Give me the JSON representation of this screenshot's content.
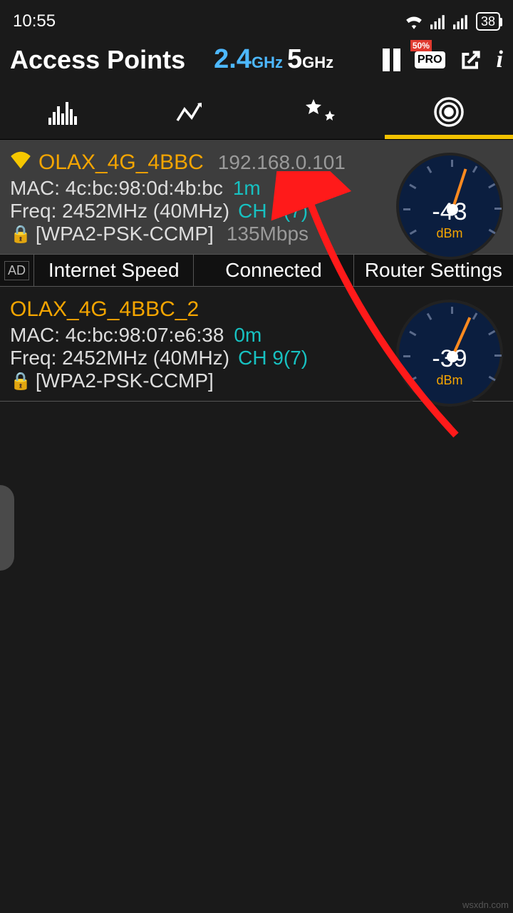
{
  "status": {
    "time": "10:55",
    "battery": "38"
  },
  "header": {
    "title": "Access Points",
    "band24_num": "2.4",
    "band24_unit": "GHz",
    "band5_num": "5",
    "band5_unit": "GHz",
    "pro_label": "PRO"
  },
  "ad": {
    "tag": "AD",
    "c1": "Internet Speed",
    "c2": "Connected",
    "c3": "Router Settings"
  },
  "ap1": {
    "ssid": "OLAX_4G_4BBC",
    "ip": "192.168.0.101",
    "mac_label": "MAC: ",
    "mac": "4c:bc:98:0d:4b:bc",
    "dist": "1m",
    "freq_label": "Freq: ",
    "freq": "2452MHz  (40MHz)",
    "channel": "CH 9(7)",
    "security": "[WPA2-PSK-CCMP]",
    "rate": "135Mbps",
    "signal": "-43",
    "unit": "dBm"
  },
  "ap2": {
    "ssid": "OLAX_4G_4BBC_2",
    "mac_label": "MAC: ",
    "mac": "4c:bc:98:07:e6:38",
    "dist": "0m",
    "freq_label": "Freq: ",
    "freq": "2452MHz  (40MHz)",
    "channel": "CH 9(7)",
    "security": "[WPA2-PSK-CCMP]",
    "signal": "-39",
    "unit": "dBm"
  },
  "watermark": "wsxdn.com"
}
